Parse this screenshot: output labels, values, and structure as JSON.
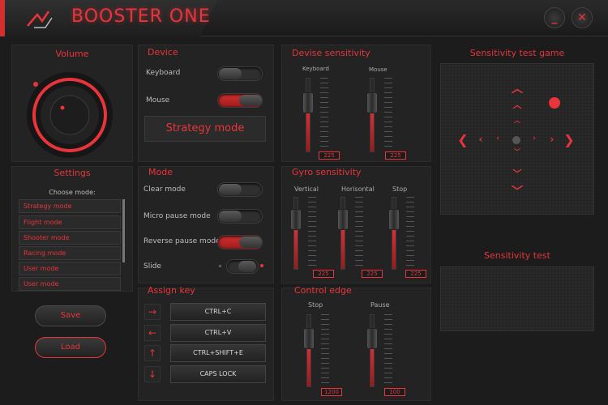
{
  "app": {
    "title": "BOOSTER ONE"
  },
  "window": {
    "minimize": "_",
    "close": "✕"
  },
  "volume": {
    "title": "Volume"
  },
  "device": {
    "title": "Device",
    "keyboard_label": "Keyboard",
    "mouse_label": "Mouse",
    "keyboard_on": false,
    "mouse_on": true,
    "current_mode": "Strategy mode"
  },
  "device_sensitivity": {
    "title": "Devise sensitivity",
    "keyboard_label": "Keyboard",
    "mouse_label": "Mouse",
    "keyboard_value": "225",
    "mouse_value": "225"
  },
  "settings": {
    "title": "Settings",
    "choose_label": "Choose mode:",
    "modes": [
      "Strategy mode",
      "Flight mode",
      "Shooter mode",
      "Racing mode",
      "User mode",
      "User mode"
    ],
    "save": "Save",
    "load": "Load"
  },
  "mode": {
    "title": "Mode",
    "clear": "Clear mode",
    "micro_pause": "Micro pause mode",
    "reverse_pause": "Reverse pause mode",
    "slide": "Slide"
  },
  "gyro": {
    "title": "Gyro sensitivity",
    "vertical": "Vertical",
    "horizontal": "Horisontal",
    "stop": "Stop",
    "vertical_value": "225",
    "horizontal_value": "225",
    "stop_value": "225"
  },
  "assign_key": {
    "title": "Assign key",
    "keys": [
      "CTRL+C",
      "CTRL+V",
      "CTRL+SHIFT+E",
      "CAPS LOCK"
    ],
    "arrows": [
      "→",
      "←",
      "↑",
      "↓"
    ]
  },
  "control_edge": {
    "title": "Control edge",
    "stop": "Stop",
    "pause": "Pause",
    "stop_value": "1200",
    "pause_value": "100"
  },
  "sensitivity_test_game": {
    "title": "Sensitivity test game"
  },
  "sensitivity_test": {
    "title": "Sensitivity test"
  },
  "colors": {
    "accent": "#e8343a",
    "background": "#1c1c1c",
    "panel": "#232323"
  }
}
